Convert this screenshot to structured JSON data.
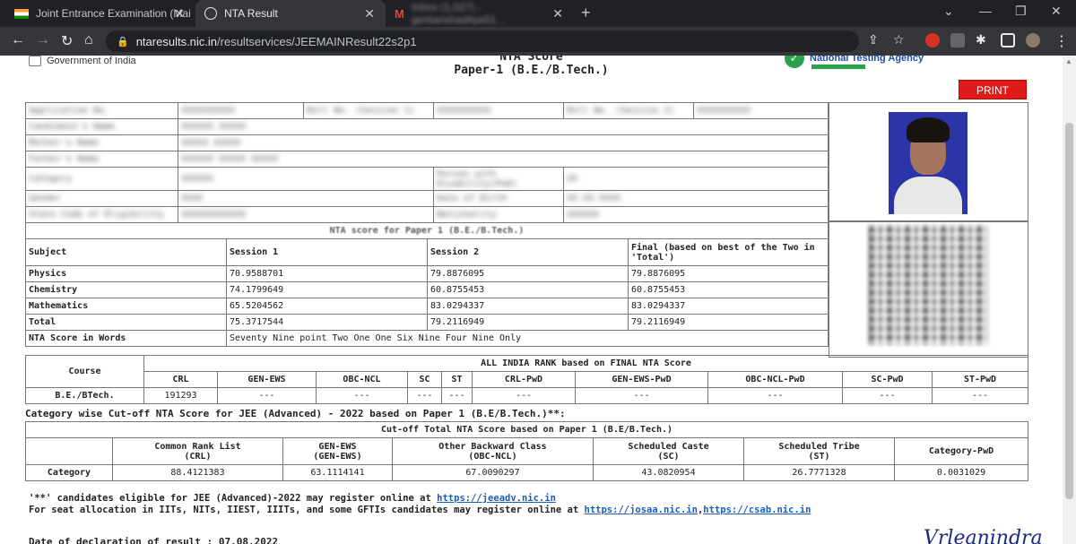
{
  "browser": {
    "tabs": [
      {
        "title": "Joint Entrance Examination (Mai",
        "active": false
      },
      {
        "title": "NTA Result",
        "active": true
      },
      {
        "title": "Inbox (1,027) - gentanshaditya51...",
        "active": false
      }
    ],
    "url_host": "ntaresults.nic.in",
    "url_path": "/resultservices/JEEMAINResult22s2p1",
    "icons": [
      "back-icon",
      "forward-icon",
      "reload-icon",
      "home-icon",
      "lock-icon",
      "share-icon",
      "star-icon",
      "extensions-icon",
      "sidebar-icon",
      "profile-icon",
      "menu-icon"
    ]
  },
  "header": {
    "gov": "Government of India",
    "title": "NTA Score",
    "subtitle": "Paper-1 (B.E./B.Tech.)",
    "agency": "National Testing Agency",
    "print_label": "PRINT"
  },
  "candidate": {
    "rows": [
      [
        "Application No.",
        "XXXXXXXXXX",
        "Roll No. (Session 1)",
        "XXXXXXXXXX",
        "Roll No. (Session 2)",
        "XXXXXXXXXX"
      ],
      [
        "Candidate's Name",
        "XXXXXX XXXXX"
      ],
      [
        "Mother's Name",
        "XXXXX XXXXX"
      ],
      [
        "Father's Name",
        "XXXXXX XXXXX XXXXX"
      ],
      [
        "Category",
        "XXXXXX",
        "Person with Disability(PwD)",
        "XX"
      ],
      [
        "Gender",
        "XXXX",
        "Date of Birth",
        "XX-XX-XXXX"
      ],
      [
        "State Code of Eligibility",
        "XXXXXXXXXXXX",
        "Nationality",
        "XXXXXX"
      ]
    ]
  },
  "scores": {
    "caption": "NTA score for Paper 1 (B.E./B.Tech.)",
    "headers": [
      "Subject",
      "Session 1",
      "Session 2",
      "Final (based on best of the Two in 'Total')"
    ],
    "rows": [
      [
        "Physics",
        "70.9588701",
        "79.8876095",
        "79.8876095"
      ],
      [
        "Chemistry",
        "74.1799649",
        "60.8755453",
        "60.8755453"
      ],
      [
        "Mathematics",
        "65.5204562",
        "83.0294337",
        "83.0294337"
      ],
      [
        "Total",
        "75.3717544",
        "79.2116949",
        "79.2116949"
      ]
    ],
    "words_label": "NTA Score in Words",
    "words_value": "Seventy Nine point Two One One Six Nine Four Nine Only"
  },
  "rank": {
    "course_label": "Course",
    "caption": "ALL INDIA RANK based on FINAL NTA Score",
    "headers": [
      "CRL",
      "GEN-EWS",
      "OBC-NCL",
      "SC",
      "ST",
      "CRL-PwD",
      "GEN-EWS-PwD",
      "OBC-NCL-PwD",
      "SC-PwD",
      "ST-PwD"
    ],
    "course": "B.E./BTech.",
    "values": [
      "191293",
      "---",
      "---",
      "---",
      "---",
      "---",
      "---",
      "---",
      "---",
      "---"
    ]
  },
  "cutoff": {
    "title": "Category wise Cut-off NTA Score for JEE (Advanced) - 2022 based on Paper 1 (B.E/B.Tech.)**:",
    "caption": "Cut-off Total NTA Score based on Paper 1 (B.E/B.Tech.)",
    "headers": [
      [
        "Common Rank List",
        "(CRL)"
      ],
      [
        "GEN-EWS",
        "(GEN-EWS)"
      ],
      [
        "Other Backward Class",
        "(OBC-NCL)"
      ],
      [
        "Scheduled Caste",
        "(SC)"
      ],
      [
        "Scheduled Tribe",
        "(ST)"
      ],
      [
        "Category-PwD",
        ""
      ]
    ],
    "row_label": "Category",
    "values": [
      "88.4121383",
      "63.1114141",
      "67.0090297",
      "43.0820954",
      "26.7771328",
      "0.0031029"
    ]
  },
  "footer": {
    "line1_text": "'**' candidates eligible for JEE (Advanced)-2022 may register online at ",
    "line1_link": "https://jeeadv.nic.in",
    "line2_text": "For seat allocation in IITs, NITs, IIEST, IIITs, and some GFTIs candidates may register online at ",
    "line2_link1": "https://josaa.nic.in",
    "line2_sep": ",",
    "line2_link2": "https://csab.nic.in",
    "declaration": "Date of declaration of result : 07.08.2022",
    "signature": "Vrleanindra"
  }
}
